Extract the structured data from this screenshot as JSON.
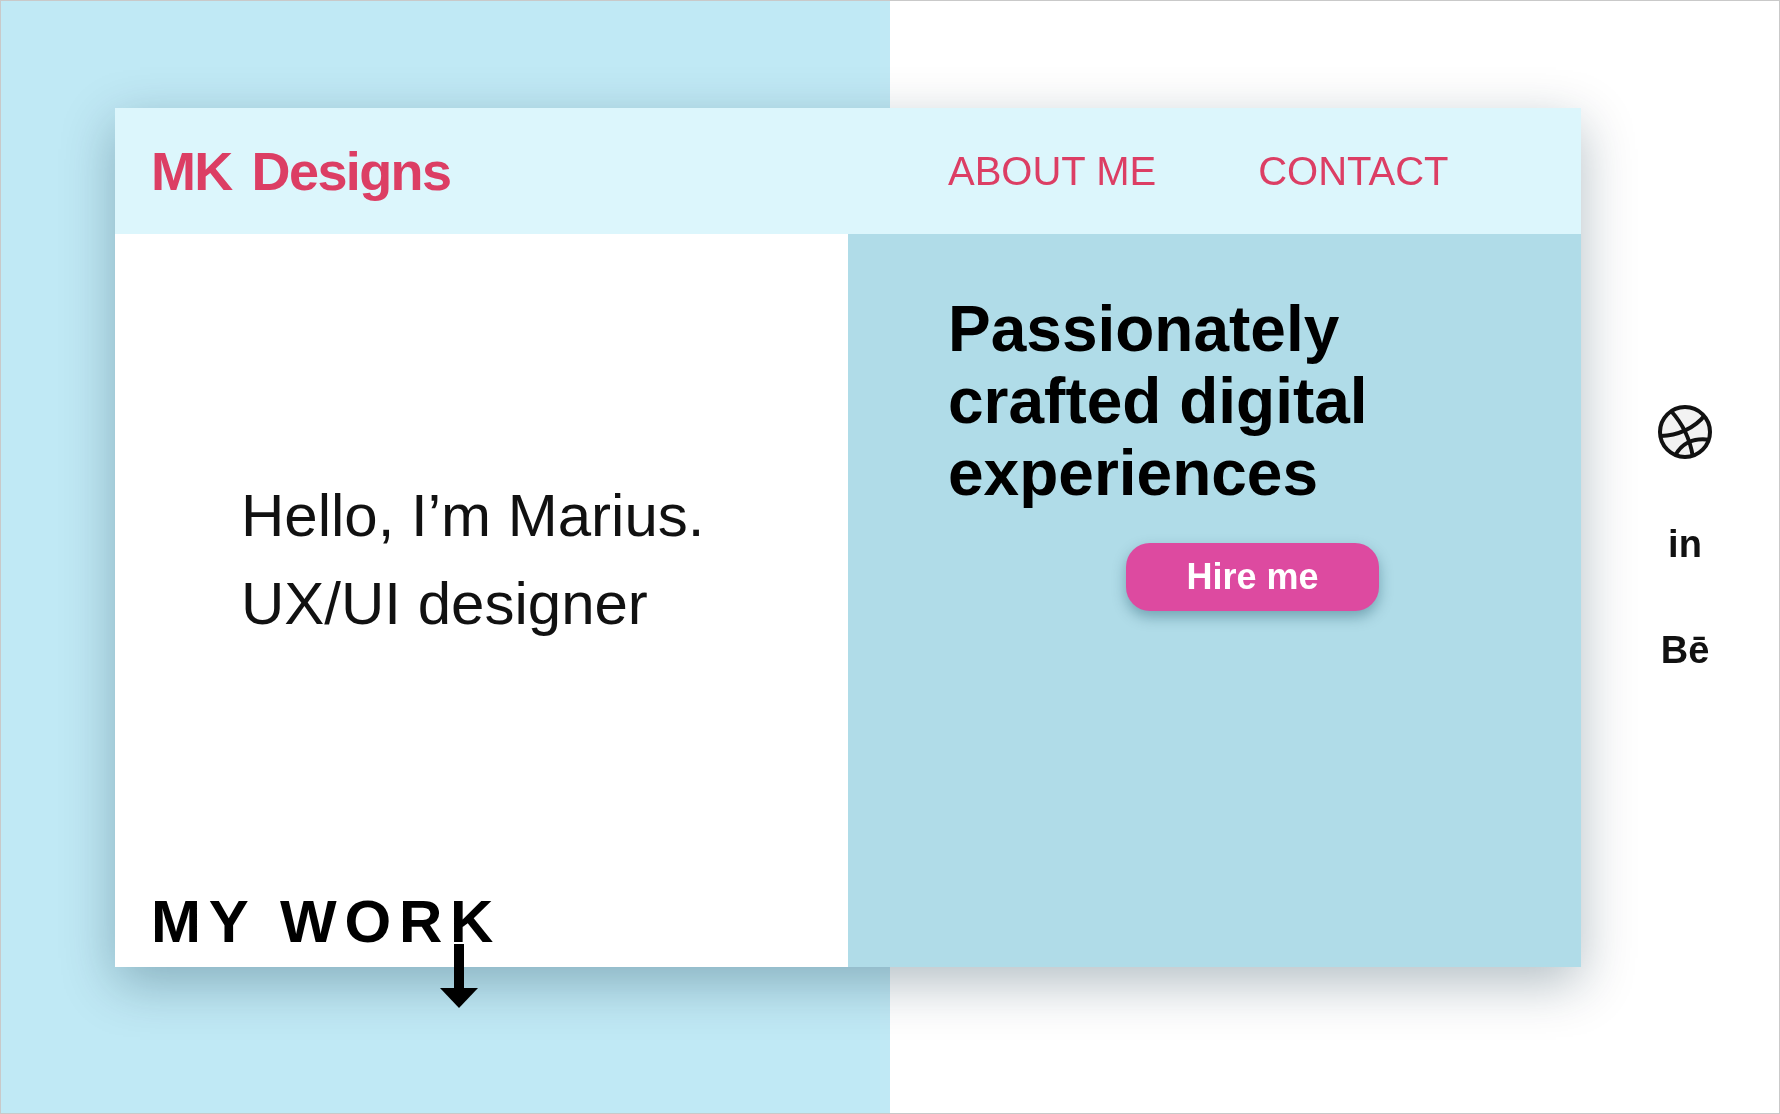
{
  "logo": {
    "text": "MK Designs"
  },
  "nav": [
    {
      "label": "ABOUT ME"
    },
    {
      "label": "CONTACT"
    }
  ],
  "intro": {
    "lines": [
      "Hello, I’m Marius.",
      "UX/UI designer"
    ]
  },
  "my_work": {
    "label": "MY WORK"
  },
  "headline": "Passionately crafted digital experiences",
  "hire_button": {
    "label": "Hire me"
  },
  "social_links": [
    {
      "kind": "icon"
    },
    {
      "kind": "text",
      "label": "in"
    },
    {
      "kind": "text",
      "label": "Bē"
    }
  ]
}
